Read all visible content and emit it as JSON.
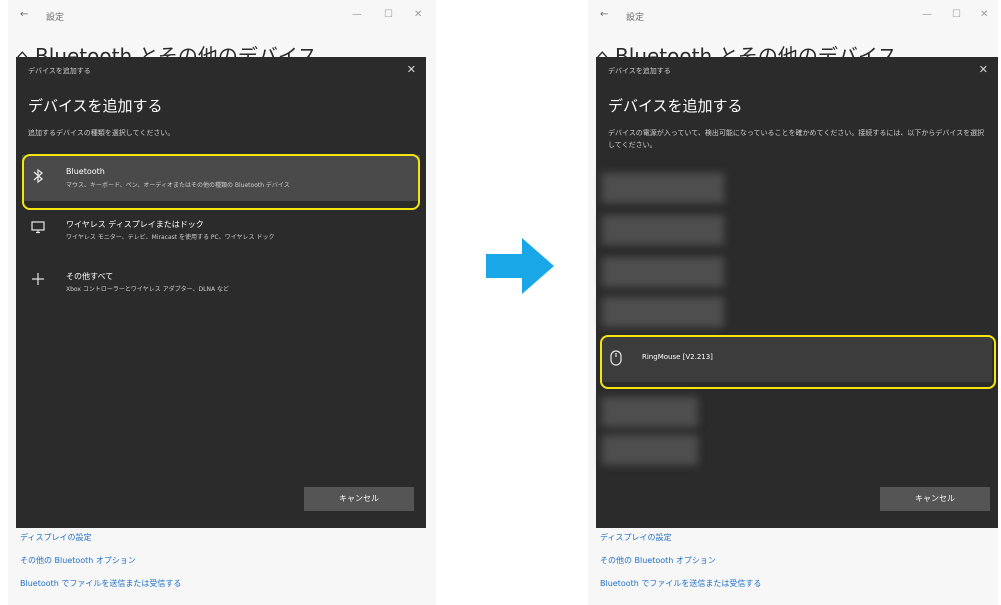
{
  "left": {
    "titlebar": {
      "title": "設定",
      "back": "←",
      "minimize": "—",
      "maximize": "☐",
      "close": "✕"
    },
    "background": {
      "heading": "⌂ Bluetooth とその他のデバイス",
      "links": [
        "ディスプレイの設定",
        "その他の Bluetooth オプション",
        "Bluetooth でファイルを送信または受信する"
      ]
    },
    "dialog": {
      "header": "デバイスを追加する",
      "close": "✕",
      "title": "デバイスを追加する",
      "subtitle": "追加するデバイスの種類を選択してください。",
      "options": [
        {
          "icon": "bluetooth-icon",
          "title": "Bluetooth",
          "desc": "マウス、キーボード、ペン、オーディオまたはその他の種類の Bluetooth デバイス"
        },
        {
          "icon": "monitor-icon",
          "title": "ワイヤレス ディスプレイまたはドック",
          "desc": "ワイヤレス モニター、テレビ、Miracast を使用する PC、ワイヤレス ドック"
        },
        {
          "icon": "plus-icon",
          "title": "その他すべて",
          "desc": "Xbox コントローラーとワイヤレス アダプター、DLNA など"
        }
      ],
      "cancel": "キャンセル"
    }
  },
  "right": {
    "titlebar": {
      "title": "設定",
      "back": "←",
      "minimize": "—",
      "maximize": "☐",
      "close": "✕"
    },
    "background": {
      "heading": "⌂ Bluetooth とその他のデバイス",
      "links": [
        "ディスプレイの設定",
        "その他の Bluetooth オプション",
        "Bluetooth でファイルを送信または受信する"
      ]
    },
    "dialog": {
      "header": "デバイスを追加する",
      "close": "✕",
      "title": "デバイスを追加する",
      "subtitle": "デバイスの電源が入っていて、検出可能になっていることを確かめてください。接続するには、以下からデバイスを選択してください。",
      "device": {
        "icon": "mouse-icon",
        "name": "RingMouse [V2.213]"
      },
      "cancel": "キャンセル"
    }
  },
  "colors": {
    "highlight": "#f5e50f",
    "arrow": "#1aa7e8",
    "dialog_bg": "#2b2b2b",
    "link": "#1f6fc5"
  }
}
